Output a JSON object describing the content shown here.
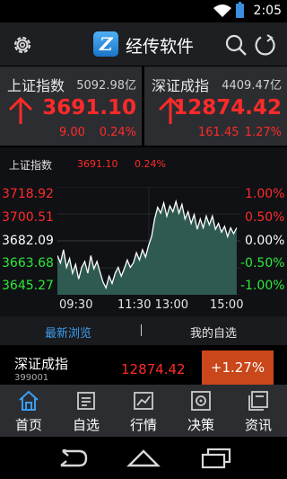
{
  "status": {
    "time": "2:05"
  },
  "app": {
    "title": "经传软件"
  },
  "cards": [
    {
      "name": "上证指数",
      "volume": "5092.98亿",
      "price": "3691.10",
      "change": "9.00",
      "pct": "0.24%"
    },
    {
      "name": "深证成指",
      "volume": "4409.47亿",
      "price": "12874.42",
      "change": "161.45",
      "pct": "1.27%"
    }
  ],
  "chart": {
    "title": "上证指数",
    "price": "3691.10",
    "pct": "0.24%",
    "y_labels_left": [
      "3718.92",
      "3700.51",
      "3682.09",
      "3663.68",
      "3645.27"
    ],
    "y_labels_right": [
      "1.00%",
      "0.50%",
      "0.00%",
      "-0.50%",
      "-1.00%"
    ],
    "x_labels": [
      "09:30",
      "11:30 13:00",
      "15:00"
    ],
    "colors": {
      "up": "#ff2a2a",
      "flat": "#ffffff",
      "down": "#2ee83a",
      "line": "#ffffff",
      "fill": "#2f5a52"
    }
  },
  "chart_data": {
    "type": "area",
    "title": "上证指数",
    "x": [
      "09:30",
      "11:30/13:00",
      "15:00"
    ],
    "ylim": [
      3645.27,
      3718.92
    ],
    "series": [
      {
        "values": [
          3672,
          3667,
          3676,
          3664,
          3670,
          3660,
          3666,
          3656,
          3664,
          3668,
          3660,
          3672,
          3663,
          3668,
          3661,
          3654,
          3650,
          3658,
          3653,
          3660,
          3664,
          3658,
          3663,
          3669,
          3664,
          3667,
          3674,
          3669,
          3676,
          3671,
          3679,
          3685,
          3697,
          3705,
          3701,
          3708,
          3699,
          3706,
          3702,
          3709,
          3701,
          3707,
          3697,
          3702,
          3694,
          3700,
          3690,
          3697,
          3691,
          3699,
          3693,
          3699,
          3690,
          3694,
          3688,
          3692,
          3685,
          3691,
          3687,
          3691
        ]
      }
    ]
  },
  "tabs": {
    "recent": "最新浏览",
    "watchlist": "我的自选"
  },
  "row": {
    "name": "深证成指",
    "code": "399001",
    "price": "12874.42",
    "badge": "+1.27%"
  },
  "nav": [
    {
      "label": "首页",
      "icon": "home-icon"
    },
    {
      "label": "自选",
      "icon": "watchlist-icon"
    },
    {
      "label": "行情",
      "icon": "market-chart-icon"
    },
    {
      "label": "决策",
      "icon": "decision-target-icon"
    },
    {
      "label": "资讯",
      "icon": "news-icon"
    }
  ]
}
